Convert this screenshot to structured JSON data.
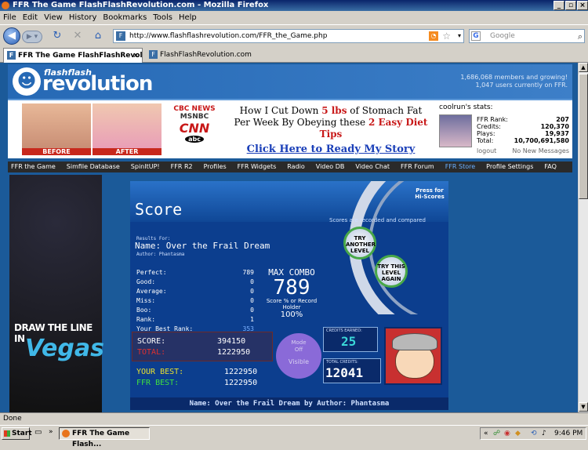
{
  "window": {
    "title": "FFR The Game FlashFlashRevolution.com - Mozilla Firefox",
    "min": "_",
    "max": "▫",
    "close": "×"
  },
  "menu": [
    "File",
    "Edit",
    "View",
    "History",
    "Bookmarks",
    "Tools",
    "Help"
  ],
  "nav": {
    "url": "http://www.flashflashrevolution.com/FFR_the_Game.php",
    "search_placeholder": "Google",
    "search_engine_icon": "G",
    "icons": {
      "back": "back-arrow-icon",
      "forward": "forward-arrow-icon",
      "reload": "reload-icon",
      "stop": "stop-icon",
      "home": "home-icon"
    }
  },
  "tabs": [
    {
      "label": "FFR The Game FlashFlashRevolu..."
    },
    {
      "label": "FlashFlashRevolution.com"
    }
  ],
  "site": {
    "logo_small": "flashflash",
    "logo_big": "revolution",
    "members_line": "1,686,068 members and growing!",
    "online_line": "1,047 users currently on FFR."
  },
  "ad": {
    "before": "BEFORE",
    "after": "AFTER",
    "networks": [
      "CBC NEWS",
      "MSNBC",
      "CNN",
      "abc"
    ],
    "headline_a": "How I Cut Down ",
    "headline_red1": "5 lbs",
    "headline_b": " of Stomach Fat Per Week By Obeying these ",
    "headline_red2": "2 Easy Diet Tips",
    "link": "Click Here to Ready My Story"
  },
  "stats": {
    "title": "coolrun's stats:",
    "rows": [
      {
        "label": "FFR Rank:",
        "value": "207"
      },
      {
        "label": "Credits:",
        "value": "120,370"
      },
      {
        "label": "Plays:",
        "value": "19,937"
      },
      {
        "label": "Total:",
        "value": "10,700,691,580"
      }
    ],
    "logout": "logout",
    "new_messages": "No New Messages"
  },
  "navstrip": [
    "FFR the Game",
    "Simfile Database",
    "SpinItUP!",
    "FFR R2",
    "Profiles",
    "FFR Widgets",
    "Radio",
    "Video DB",
    "Video Chat",
    "FFR Forum",
    "FFR Store",
    "Profile Settings",
    "FAQ"
  ],
  "side_ad": {
    "line1": "DRAW THE LINE IN",
    "line2": "Vegas"
  },
  "game": {
    "heading": "Score",
    "hs_note": "Scores are recorded and compared",
    "press_hs": "Press for Hi-Scores",
    "results_for": "Results For:",
    "song_name": "Name: Over the Frail Dream",
    "author": "Author: Phantasma",
    "try_another": "TRY ANOTHER LEVEL",
    "try_again": "TRY THIS LEVEL AGAIN",
    "counts": [
      {
        "label": "Perfect:",
        "value": "789"
      },
      {
        "label": "Good:",
        "value": "0"
      },
      {
        "label": "Average:",
        "value": "0"
      },
      {
        "label": "Miss:",
        "value": "0"
      },
      {
        "label": "Boo:",
        "value": "0"
      },
      {
        "label": "Rank:",
        "value": "1"
      },
      {
        "label": "Your Best Rank:",
        "value": "353"
      }
    ],
    "max_combo_label": "MAX COMBO",
    "max_combo": "789",
    "score_pct_label": "Score % or Record Holder",
    "score_pct": "100%",
    "score_label": "SCORE:",
    "score": "394150",
    "total_label": "TOTAL:",
    "total": "1222950",
    "your_best_label": "YOUR BEST:",
    "your_best": "1222950",
    "ffr_best_label": "FFR BEST:",
    "ffr_best": "1222950",
    "mode_top": "Mode",
    "mode_off": "Off",
    "mode_visible": "Visible",
    "credits_earned_label": "CREDITS EARNED:",
    "credits_earned": "25",
    "total_credits_label": "TOTAL CREDITS:",
    "total_credits": "12041",
    "footer": "Name: Over the Frail Dream by Author: Phantasma"
  },
  "status": "Done",
  "taskbar": {
    "start": "Start",
    "app": "FFR The Game Flash...",
    "time": "9:46 PM"
  }
}
